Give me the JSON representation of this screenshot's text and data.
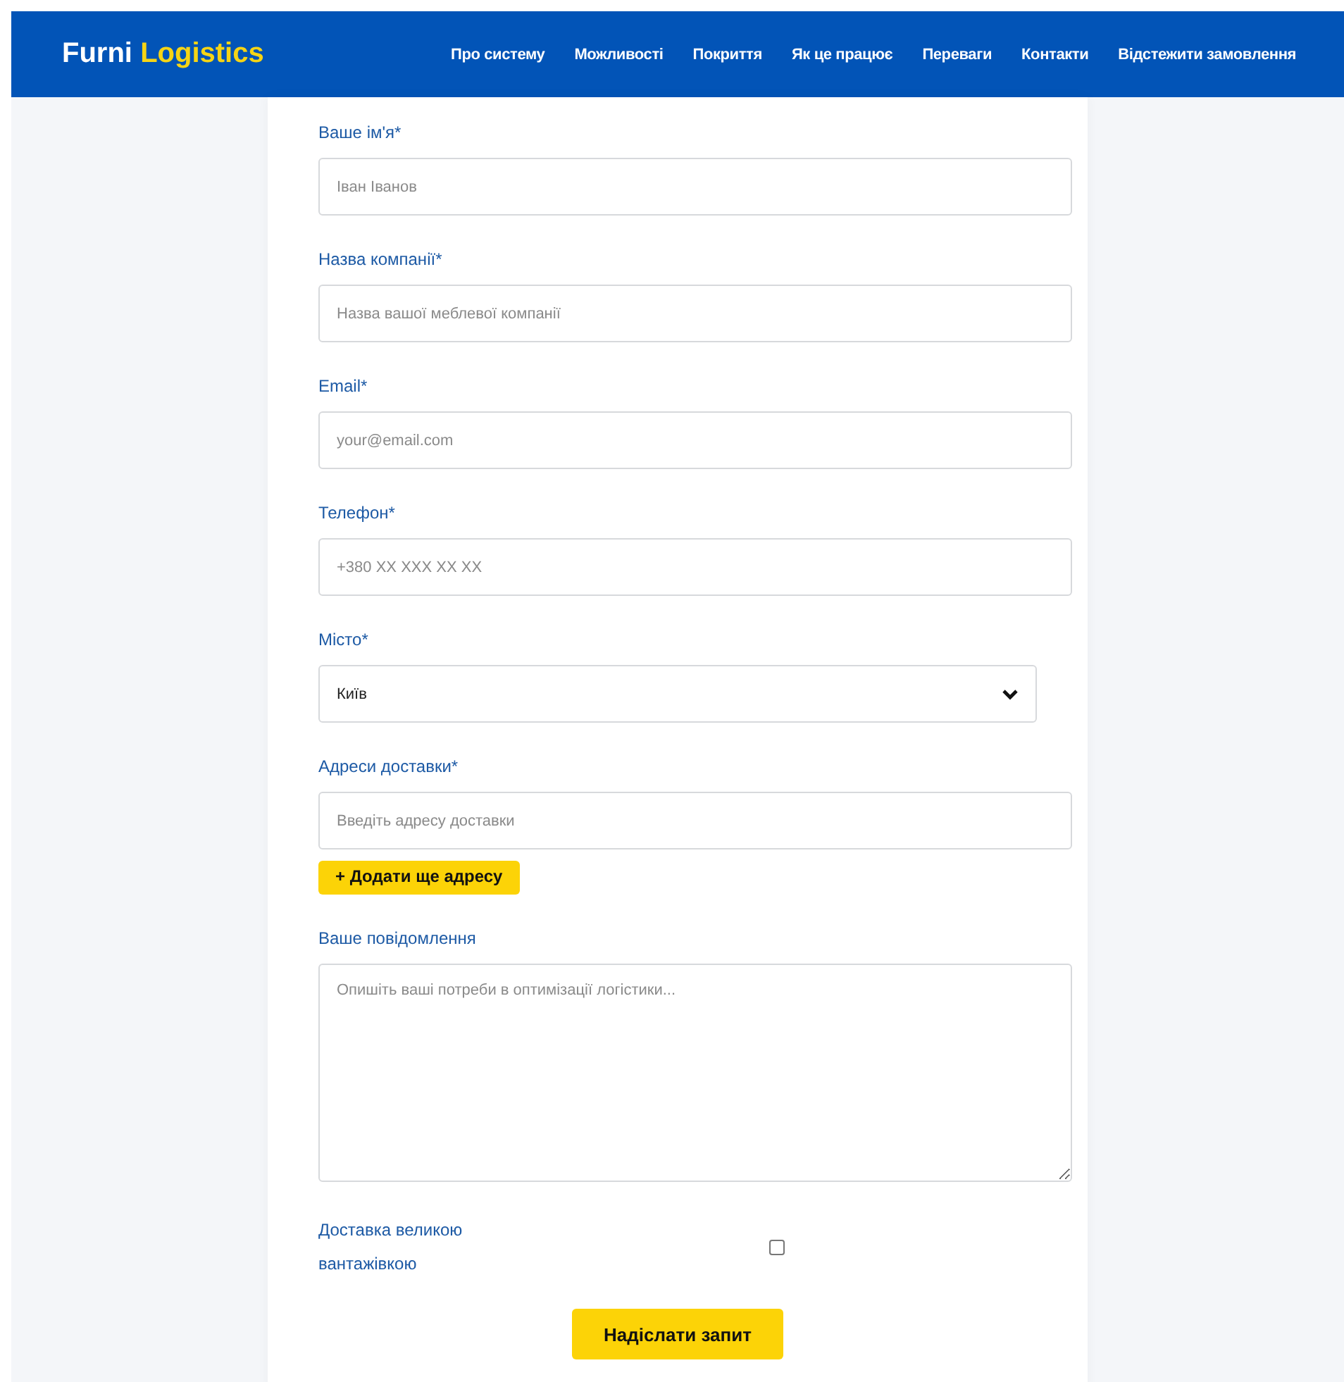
{
  "header": {
    "brand": "Furni",
    "brand_accent": "Logistics",
    "nav": [
      "Про систему",
      "Можливості",
      "Покриття",
      "Як це працює",
      "Переваги",
      "Контакти",
      "Відстежити замовлення"
    ]
  },
  "form": {
    "fields": [
      {
        "kind": "text",
        "label": "Ваше ім'я*",
        "placeholder": "Іван Іванов"
      },
      {
        "kind": "text",
        "label": "Назва компанії*",
        "placeholder": "Назва вашої меблевої компанії"
      },
      {
        "kind": "text",
        "label": "Email*",
        "placeholder": "your@email.com"
      },
      {
        "kind": "text",
        "label": "Телефон*",
        "placeholder": "+380 XX XXX XX XX"
      },
      {
        "kind": "select",
        "label": "Місто*",
        "value": "Київ"
      },
      {
        "kind": "address",
        "label": "Адреси доставки*",
        "placeholder": "Введіть адресу доставки",
        "add_button": "+ Додати ще адресу"
      },
      {
        "kind": "textarea",
        "label": "Ваше повідомлення",
        "placeholder": "Опишіть ваші потреби в оптимізації логістики..."
      },
      {
        "kind": "checkbox",
        "label": "Доставка великою вантажівкою",
        "checked": false
      }
    ],
    "submit": "Надіслати запит"
  }
}
